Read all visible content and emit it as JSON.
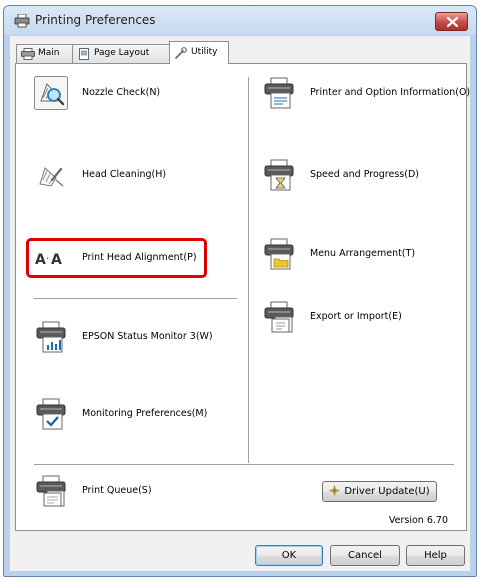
{
  "window": {
    "title": "Printing Preferences"
  },
  "tabs": [
    {
      "label": "Main",
      "icon": "printer-icon"
    },
    {
      "label": "Page Layout",
      "icon": "page-icon"
    },
    {
      "label": "Utility",
      "icon": "wrench-icon"
    }
  ],
  "utility": {
    "left_items": [
      {
        "label": "Nozzle Check(N)",
        "icon": "nozzle-check-icon"
      },
      {
        "label": "Head Cleaning(H)",
        "icon": "head-cleaning-icon"
      },
      {
        "label": "Print Head Alignment(P)",
        "icon": "print-head-alignment-icon"
      },
      {
        "label": "EPSON Status Monitor 3(W)",
        "icon": "status-monitor-icon"
      },
      {
        "label": "Monitoring Preferences(M)",
        "icon": "monitoring-preferences-icon"
      },
      {
        "label": "Print Queue(S)",
        "icon": "print-queue-icon"
      }
    ],
    "right_items": [
      {
        "label": "Printer and Option Information(O)",
        "icon": "printer-info-icon"
      },
      {
        "label": "Speed and Progress(D)",
        "icon": "speed-progress-icon"
      },
      {
        "label": "Menu Arrangement(T)",
        "icon": "menu-arrangement-icon"
      },
      {
        "label": "Export or Import(E)",
        "icon": "export-import-icon"
      }
    ],
    "driver_update_label": "Driver Update(U)",
    "version": "Version 6.70"
  },
  "footer": {
    "ok_label": "OK",
    "cancel_label": "Cancel",
    "help_label": "Help"
  },
  "colors": {
    "highlight": "#e00000",
    "titlebar": "#c6daf0",
    "close_button": "#c75050"
  }
}
